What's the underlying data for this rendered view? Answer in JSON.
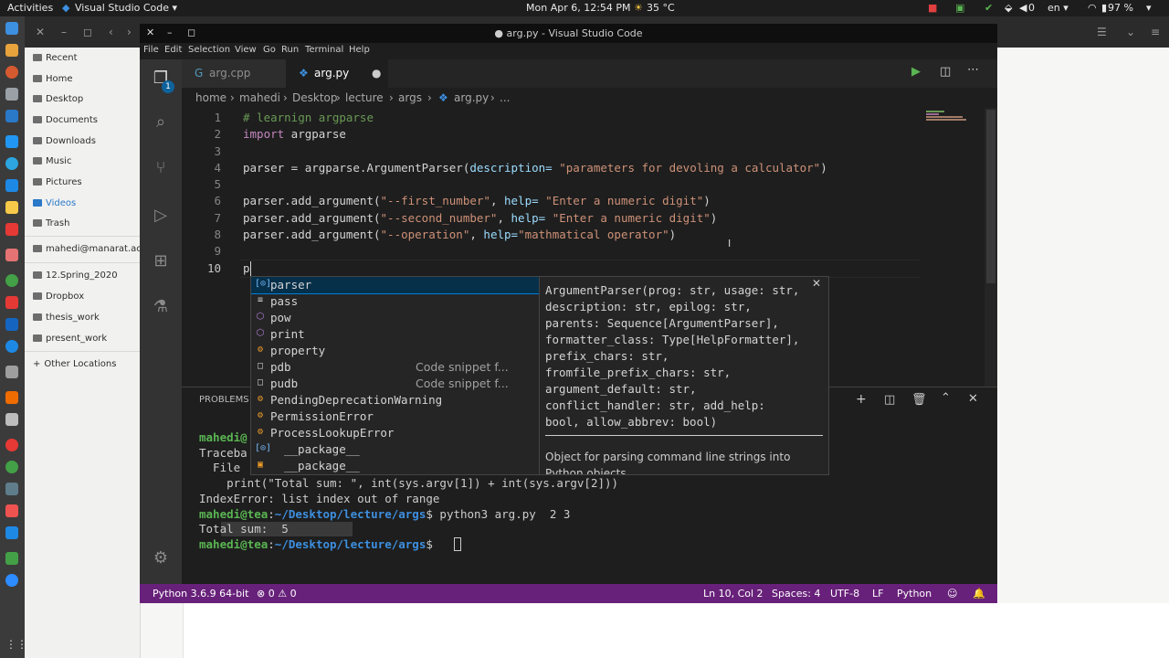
{
  "topbar": {
    "activities": "Activities",
    "app": "Visual Studio Code ▾",
    "clock": "Mon Apr  6, 12:54 PM",
    "weather": "35 °C",
    "volume": "0",
    "lang": "en ▾",
    "battery": "97 %"
  },
  "files_sidebar": {
    "items": [
      "Recent",
      "Home",
      "Desktop",
      "Documents",
      "Downloads",
      "Music",
      "Pictures",
      "Videos",
      "Trash",
      "mahedi@manarat.ac.bd",
      "12.Spring_2020",
      "Dropbox",
      "thesis_work",
      "present_work",
      "Other Locations"
    ]
  },
  "vscode": {
    "title": "● arg.py - Visual Studio Code",
    "menu": [
      "File",
      "Edit",
      "Selection",
      "View",
      "Go",
      "Run",
      "Terminal",
      "Help"
    ],
    "explorer_badge": "1",
    "tabs": [
      {
        "label": "arg.cpp"
      },
      {
        "label": "arg.py"
      }
    ],
    "breadcrumb": [
      "home",
      "mahedi",
      "Desktop",
      "lecture",
      "args",
      "arg.py",
      "..."
    ],
    "line_numbers": [
      "1",
      "2",
      "3",
      "4",
      "5",
      "6",
      "7",
      "8",
      "9",
      "10"
    ],
    "code": {
      "l1": "# learnign argparse",
      "l2_kw": "import",
      "l2_rest": " argparse",
      "l4_a": "parser = argparse.ArgumentParser(",
      "l4_pm": "description=",
      "l4_sp": " ",
      "l4_st": "\"parameters for devoling a calculator\"",
      "l4_end": ")",
      "l6_a": "parser.add_argument(",
      "l6_st1": "\"--first_number\"",
      "l6_b": ", ",
      "l6_pm": "help=",
      "l6_sp": " ",
      "l6_st2": "\"Enter a numeric digit\"",
      "l6_end": ")",
      "l7_a": "parser.add_argument(",
      "l7_st1": "\"--second_number\"",
      "l7_b": ", ",
      "l7_pm": "help=",
      "l7_sp": " ",
      "l7_st2": "\"Enter a numeric digit\"",
      "l7_end": ")",
      "l8_a": "parser.add_argument(",
      "l8_st1": "\"--operation\"",
      "l8_b": ", ",
      "l8_pm": "help=",
      "l8_st2": "\"mathmatical operator\"",
      "l8_end": ")",
      "l10": "p"
    },
    "suggestions": [
      {
        "icon": "[⊙]",
        "label": "parser",
        "detail": ""
      },
      {
        "icon": "≡",
        "label": "pass",
        "detail": ""
      },
      {
        "icon": "⬡",
        "label": "pow",
        "detail": ""
      },
      {
        "icon": "⬡",
        "label": "print",
        "detail": ""
      },
      {
        "icon": "⚙",
        "label": "property",
        "detail": ""
      },
      {
        "icon": "□",
        "label": "pdb",
        "detail": "Code snippet f..."
      },
      {
        "icon": "□",
        "label": "pudb",
        "detail": "Code snippet f..."
      },
      {
        "icon": "⚙",
        "label": "PendingDeprecationWarning",
        "detail": ""
      },
      {
        "icon": "⚙",
        "label": "PermissionError",
        "detail": ""
      },
      {
        "icon": "⚙",
        "label": "ProcessLookupError",
        "detail": ""
      },
      {
        "icon": "[⊙]",
        "label": "__package__",
        "detail": ""
      },
      {
        "icon": "▣",
        "label": "__package__",
        "detail": ""
      }
    ],
    "doc": {
      "signature": "ArgumentParser(prog: str, usage: str,\ndescription: str, epilog: str,\nparents: Sequence[ArgumentParser],\nformatter_class: Type[HelpFormatter],\nprefix_chars: str,\nfromfile_prefix_chars: str,\nargument_default: str,\nconflict_handler: str, add_help:\nbool, allow_abbrev: bool)",
      "description": "Object for parsing command line strings into Python objects."
    },
    "panel": {
      "tab": "PROBLEMS"
    },
    "terminal": {
      "l1_prompt": "mahedi@",
      "l2": "Traceba",
      "l3": "  File",
      "l4": "    print(\"Total sum: \", int(sys.argv[1]) + int(sys.argv[2]))",
      "l5": "IndexError: list index out of range",
      "l6_user": "mahedi@tea",
      "l6_colon": ":",
      "l6_path": "~/Desktop/lecture/args",
      "l6_cmd": "$ python3 arg.py  2 3",
      "l7": "Total sum:  5",
      "l8_user": "mahedi@tea",
      "l8_colon": ":",
      "l8_path": "~/Desktop/lecture/args",
      "l8_cmd": "$ "
    },
    "status": {
      "python": "Python 3.6.9 64-bit",
      "problems": "⊗ 0 ⚠ 0",
      "position": "Ln 10, Col 2",
      "spaces": "Spaces: 4",
      "encoding": "UTF-8",
      "eol": "LF",
      "language": "Python"
    },
    "colors": {
      "status_bar": "#68217a",
      "accent": "#007fd4"
    }
  }
}
